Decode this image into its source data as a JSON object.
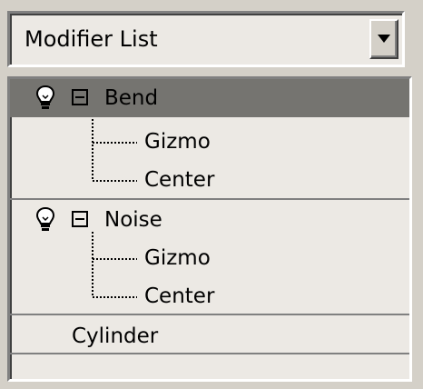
{
  "dropdown": {
    "label": "Modifier List"
  },
  "stack": {
    "modifiers": [
      {
        "name": "Bend",
        "selected": true,
        "subs": [
          "Gizmo",
          "Center"
        ]
      },
      {
        "name": "Noise",
        "selected": false,
        "subs": [
          "Gizmo",
          "Center"
        ]
      }
    ],
    "base_object": "Cylinder"
  },
  "colors": {
    "panel": "#d4d0c8",
    "list_bg": "#ece9e4",
    "selected_row": "#757470",
    "separator": "#808080"
  }
}
